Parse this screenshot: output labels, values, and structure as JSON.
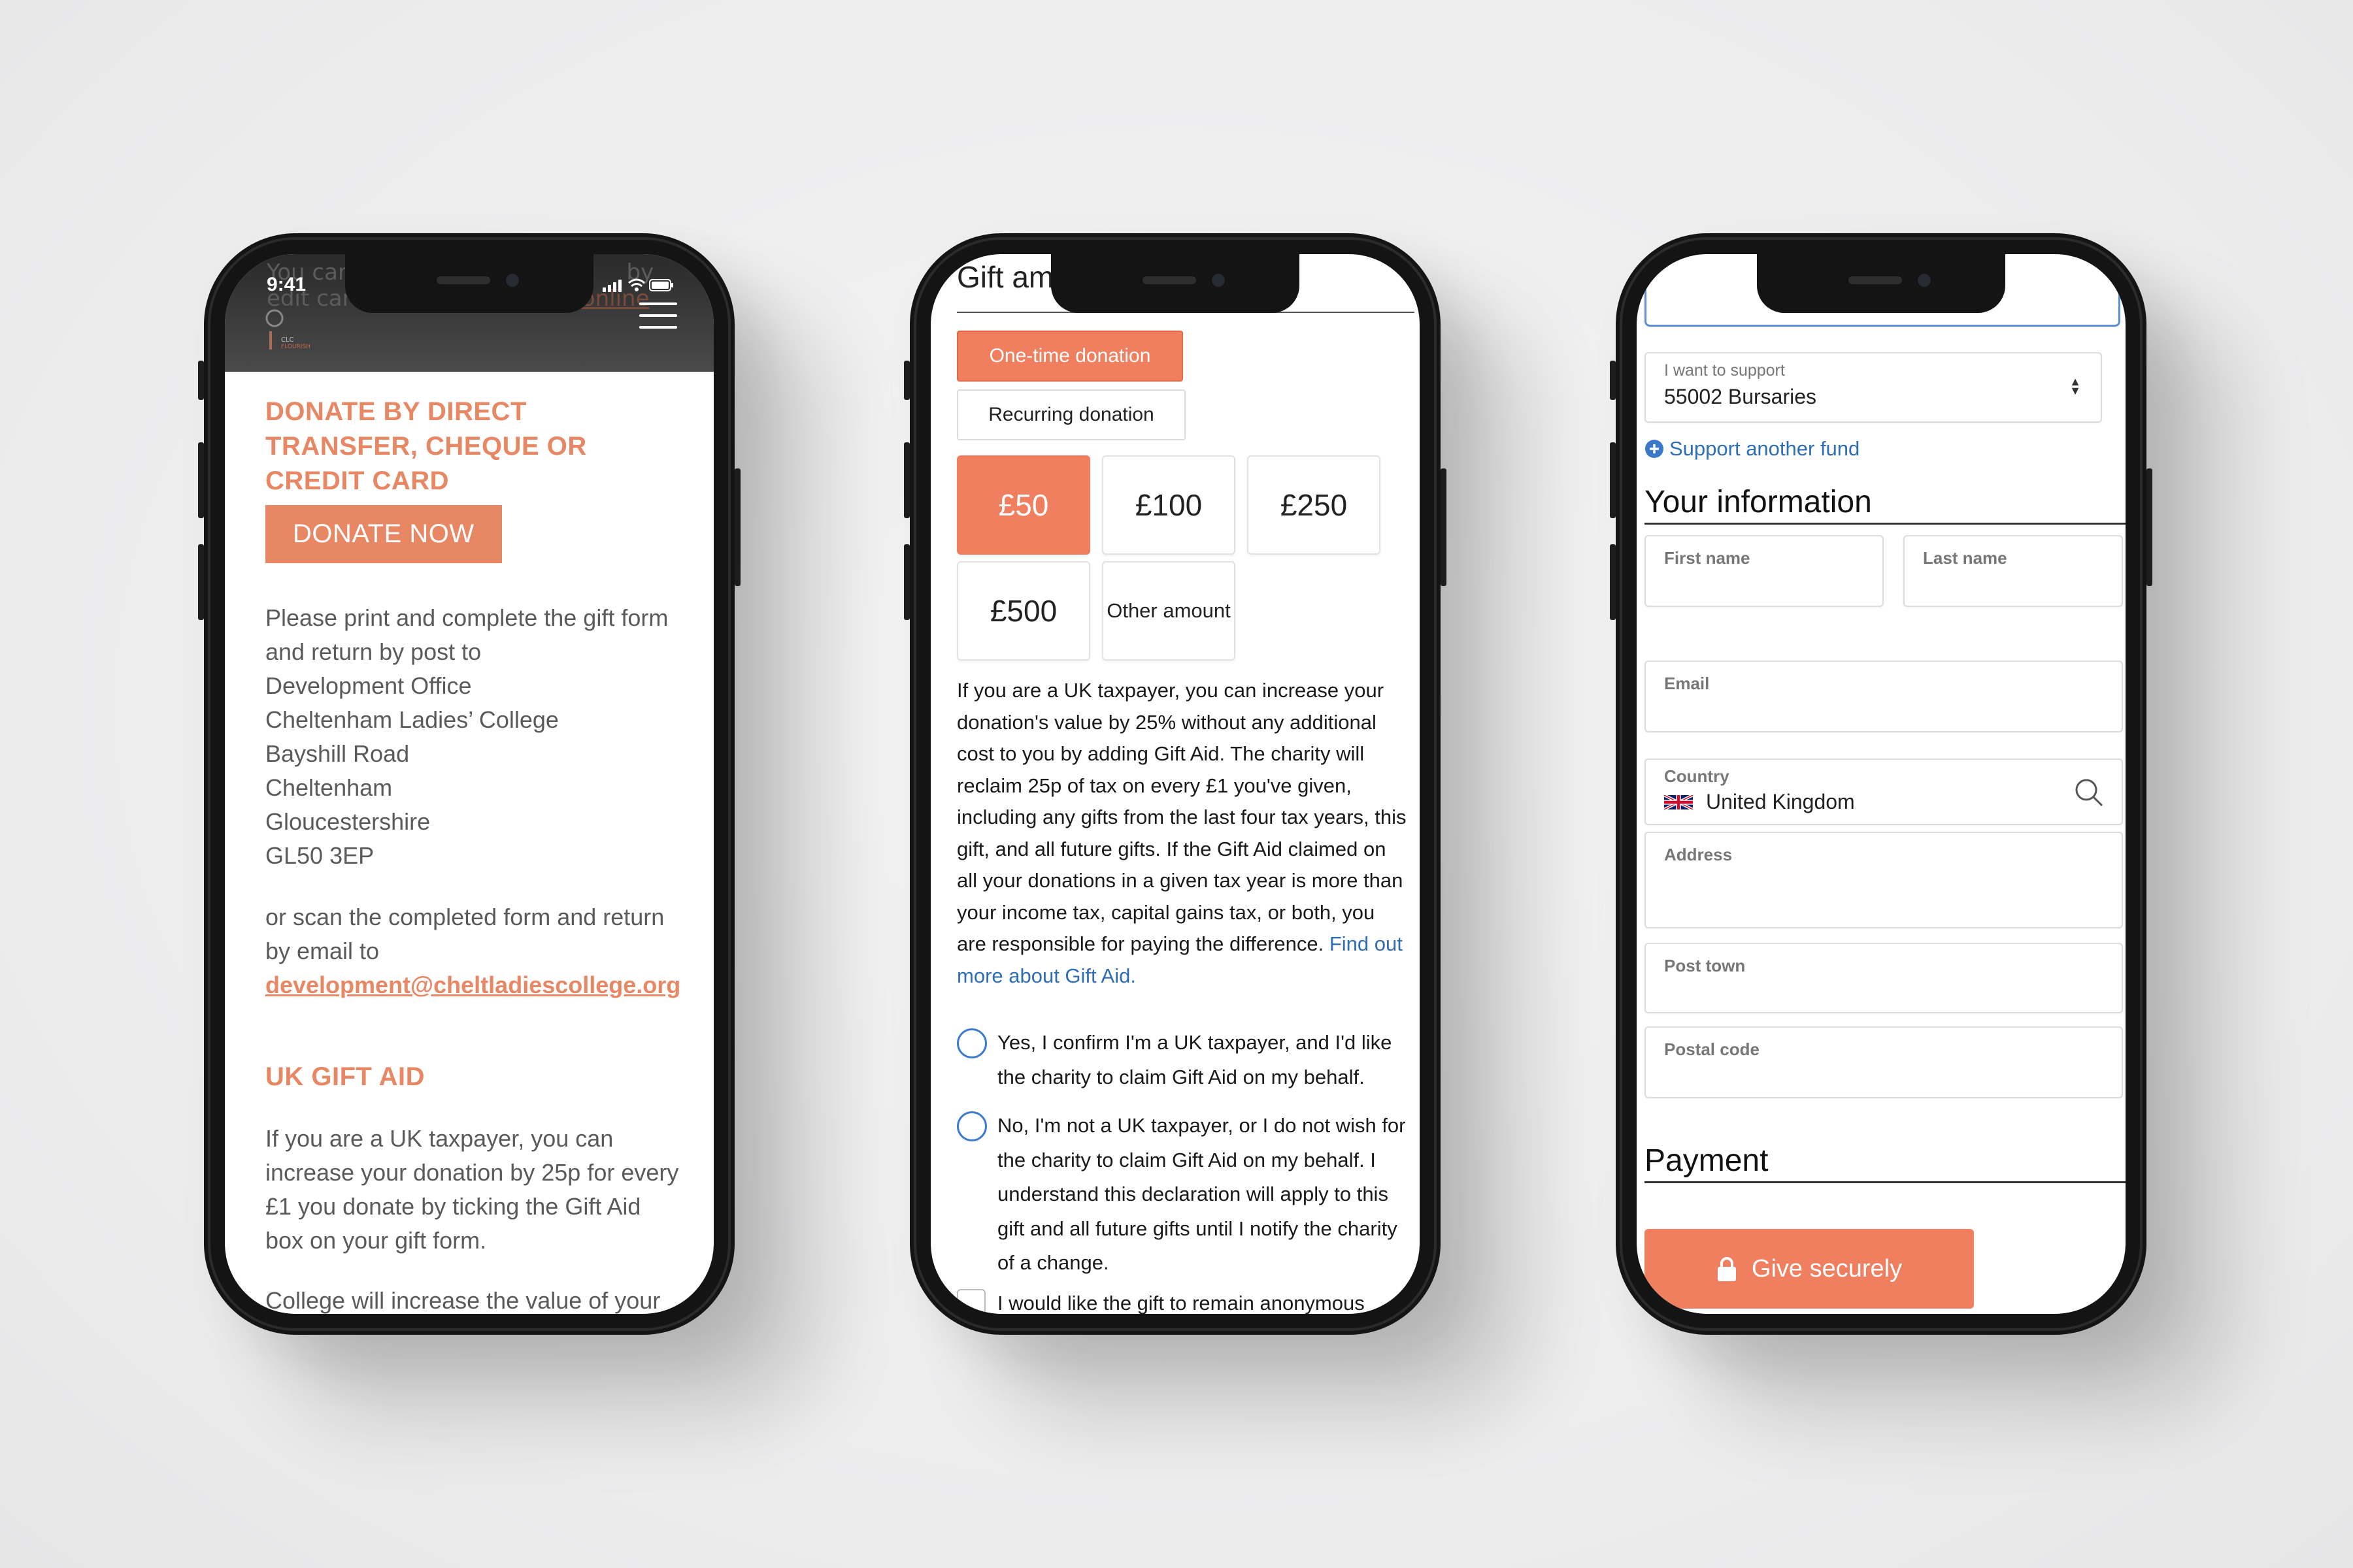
{
  "phone1": {
    "status_time": "9:41",
    "ghost_line1": "You can",
    "ghost_line1_b": "by",
    "ghost_line2": "edit card by completing the",
    "ghost_line2_link": "online",
    "logo_text": "CLC FLOURISH",
    "heading1": "DONATE BY DIRECT TRANSFER, CHEQUE OR CREDIT CARD",
    "donate_button": "DONATE NOW",
    "address_intro": "Please print and complete the gift form and return by post to",
    "address_lines": [
      "Development Office",
      "Cheltenham Ladies’ College",
      "Bayshill Road",
      "Cheltenham",
      "Gloucestershire",
      "GL50 3EP"
    ],
    "scan_text": "or scan the completed form and return by email to",
    "email_link": "development@cheltladiescollege.org",
    "heading2": "UK GIFT AID",
    "gift_aid_text": "If you are a UK taxpayer, you can increase your donation by 25p for every £1 you donate by ticking the Gift Aid box on your gift form.",
    "cutoff_text": "College will increase the value of your"
  },
  "phone2": {
    "top_title": "Gift amo",
    "one_time": "One-time donation",
    "recurring": "Recurring donation",
    "amounts": [
      "£50",
      "£100",
      "£250",
      "£500"
    ],
    "other_amount": "Other amount",
    "gift_aid_para": "If you are a UK taxpayer, you can increase your donation's value by 25% without any additional cost to you by adding Gift Aid. The charity will reclaim 25p of tax on every £1 you've given, including any gifts from the last four tax years, this gift, and all future gifts. If the Gift Aid claimed on all your donations in a given tax year is more than your income tax, capital gains tax, or both, you are responsible for paying the difference.",
    "gift_aid_link": "Find out more about Gift Aid.",
    "radio_yes": "Yes, I confirm I'm a UK taxpayer, and I'd like the charity to claim Gift Aid on my behalf.",
    "radio_no": "No, I'm not a UK taxpayer, or I do not wish for the charity to claim Gift Aid on my behalf. I understand this declaration will apply to this gift and all future gifts until I notify the charity of a change.",
    "anonymous": "I would like the gift to remain anonymous"
  },
  "phone3": {
    "support_label": "I want to support",
    "support_value": "55002 Bursaries",
    "support_another": "Support another fund",
    "your_info": "Your information",
    "first_name": "First name",
    "last_name": "Last name",
    "email": "Email",
    "country_label": "Country",
    "country_value": "United Kingdom",
    "address": "Address",
    "post_town": "Post town",
    "postal_code": "Postal code",
    "payment": "Payment",
    "give_button": "Give securely"
  },
  "colors": {
    "accent": "#ef7f5f",
    "link": "#2f6db5",
    "heading_accent": "#e88764"
  }
}
